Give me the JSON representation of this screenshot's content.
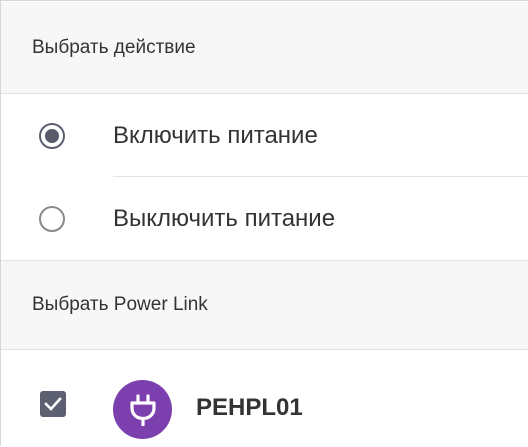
{
  "sections": {
    "action_header": "Выбрать действие",
    "link_header": "Выбрать Power Link"
  },
  "options": {
    "power_on": {
      "label": "Включить питание",
      "selected": true
    },
    "power_off": {
      "label": "Выключить питание",
      "selected": false
    }
  },
  "device": {
    "name": "PEHPL01",
    "checked": true,
    "icon": "plug-icon",
    "avatar_color": "#7b3fae"
  },
  "colors": {
    "radio_selected": "#575b6a",
    "checkbox": "#5c6070"
  }
}
